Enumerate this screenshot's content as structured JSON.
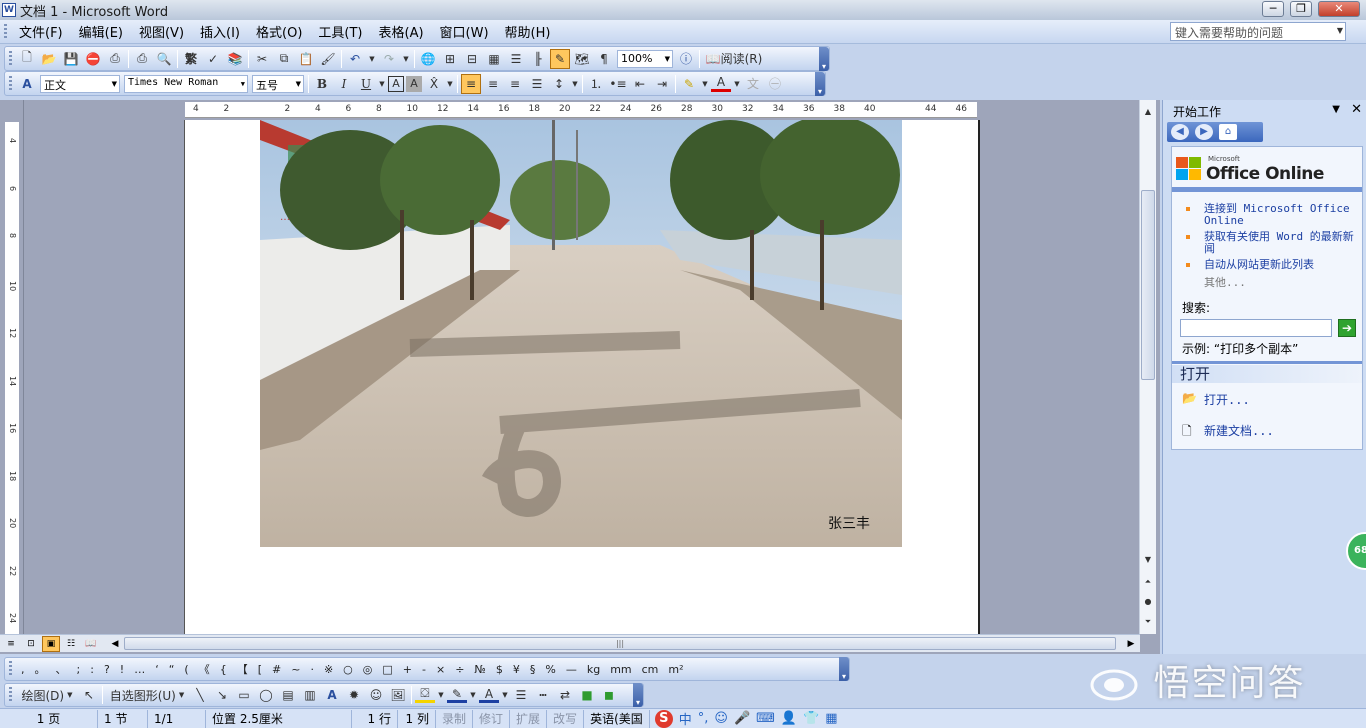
{
  "window": {
    "title": "文档 1 - Microsoft Word",
    "minimize": "─",
    "restore": "❐",
    "close": "✕"
  },
  "menubar": {
    "items": [
      "文件(F)",
      "编辑(E)",
      "视图(V)",
      "插入(I)",
      "格式(O)",
      "工具(T)",
      "表格(A)",
      "窗口(W)",
      "帮助(H)"
    ],
    "help_placeholder": "键入需要帮助的问题"
  },
  "standard_toolbar": {
    "zoom": "100%",
    "read_label": "阅读(R)"
  },
  "formatting_toolbar": {
    "style": "正文",
    "font": "Times New Roman",
    "size": "五号",
    "bold": "B",
    "italic": "I",
    "underline": "U"
  },
  "ruler": {
    "h_ticks": [
      "4",
      "2",
      "",
      "2",
      "4",
      "6",
      "8",
      "10",
      "12",
      "14",
      "16",
      "18",
      "20",
      "22",
      "24",
      "26",
      "28",
      "30",
      "32",
      "34",
      "36",
      "38",
      "40",
      "",
      "44",
      "46"
    ],
    "v_ticks": [
      "4",
      "6",
      "8",
      "10",
      "12",
      "14",
      "16",
      "18",
      "20",
      "22",
      "24"
    ],
    "corner": "L"
  },
  "document": {
    "photo_caption": "张三丰"
  },
  "task_pane": {
    "title": "开始工作",
    "logo_small": "Microsoft",
    "logo_name": "Office Online",
    "links": [
      "连接到 Microsoft Office Online",
      "获取有关使用 Word 的最新新闻",
      "自动从网站更新此列表"
    ],
    "more": "其他...",
    "search_label": "搜索:",
    "example": "示例:  “打印多个副本”",
    "open_header": "打开",
    "open_items": [
      "打开...",
      "新建文档..."
    ]
  },
  "float_badge": "68",
  "symbols": [
    ",",
    "。",
    "、",
    ";",
    ":",
    "?",
    "!",
    "…",
    "‘",
    "“",
    "(",
    "《",
    "{",
    "【",
    "[",
    "#",
    "~",
    "·",
    "※",
    "○",
    "◎",
    "□",
    "+",
    "-",
    "×",
    "÷",
    "№",
    "$",
    "¥",
    "§",
    "%",
    "—",
    "kg",
    "mm",
    "cm",
    "m²"
  ],
  "drawing_toolbar": {
    "draw": "绘图(D)",
    "autoshapes": "自选图形(U)"
  },
  "statusbar": {
    "page": "1 页",
    "section": "1 节",
    "pages": "1/1",
    "position": "位置 2.5厘米",
    "line": "1 行",
    "column": "1 列",
    "rec": "录制",
    "trk": "修订",
    "ext": "扩展",
    "ovr": "改写",
    "lang": "英语(美国",
    "ime": "中"
  },
  "watermark": "悟空问答"
}
